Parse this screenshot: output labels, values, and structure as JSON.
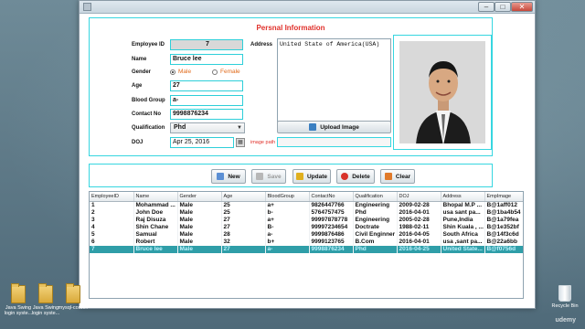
{
  "window": {
    "title_controls": {
      "minimize": "–",
      "maximize": "□",
      "close": "✕"
    }
  },
  "info": {
    "panel_title": "Persnal Information",
    "employee_id": {
      "label": "Employee ID",
      "value": "7"
    },
    "name": {
      "label": "Name",
      "value": "Bruce lee"
    },
    "gender": {
      "label": "Gender",
      "male": "Male",
      "female": "Female",
      "selected": "Male"
    },
    "age": {
      "label": "Age",
      "value": "27"
    },
    "blood_group": {
      "label": "Blood Group",
      "value": "a-"
    },
    "contact": {
      "label": "Contact No",
      "value": "9998876234"
    },
    "qualification": {
      "label": "Qualification",
      "value": "Phd"
    },
    "doj": {
      "label": "DOJ",
      "value": "Apr 25, 2016"
    },
    "address": {
      "label": "Address",
      "value": "United State of America(USA)"
    },
    "upload_button": "Upload Image",
    "image_path_label": "image path",
    "image_path_value": ""
  },
  "actions": {
    "new": "New",
    "save": "Save",
    "update": "Update",
    "delete": "Delete",
    "clear": "Clear"
  },
  "table": {
    "headers": [
      "EmployeeID",
      "Name",
      "Gender",
      "Age",
      "BloodGroup",
      "ContactNo",
      "Qualification",
      "DOJ",
      "Address",
      "EmpImage"
    ],
    "rows": [
      [
        "1",
        "Mohammad ...",
        "Male",
        "25",
        "a+",
        "9826447766",
        "Engineering",
        "2009-02-28",
        "Bhopal M.P ...",
        "B@1aff012"
      ],
      [
        "2",
        "John Doe",
        "Male",
        "25",
        "b-",
        "5764757475",
        "Phd",
        "2016-04-01",
        "usa sant pa...",
        "B@1ba4b54"
      ],
      [
        "3",
        "Raj Disuza",
        "Male",
        "27",
        "a+",
        "99997878778",
        "Engineering",
        "2005-02-28",
        "Pune,India",
        "B@1a79fea"
      ],
      [
        "4",
        "Shin Chane",
        "Male",
        "27",
        "B-",
        "99997234654",
        "Doctrate",
        "1988-02-11",
        "Shin Kuala , ...",
        "B@1e352bf"
      ],
      [
        "5",
        "Samual",
        "Male",
        "28",
        "a-",
        "9999876486",
        "Civil Enginner",
        "2016-04-05",
        "South Africa",
        "B@14f3c6d"
      ],
      [
        "6",
        "Robert",
        "Male",
        "32",
        "b+",
        "9999123765",
        "B.Com",
        "2016-04-01",
        "usa ,sant pa...",
        "B@22a6bb"
      ],
      [
        "7",
        "Bruce lee",
        "Male",
        "27",
        "a-",
        "9998876234",
        "Phd",
        "2016-04-25",
        "United State...",
        "B@f0756d"
      ]
    ],
    "selected_row": 6
  },
  "desktop": {
    "icons": [
      {
        "label": "Java Swing login syste..."
      },
      {
        "label": "Java Swing login syste..."
      },
      {
        "label": "mysql-conn..."
      }
    ],
    "recycle_bin": "Recycle Bin",
    "watermark": "udemy"
  }
}
